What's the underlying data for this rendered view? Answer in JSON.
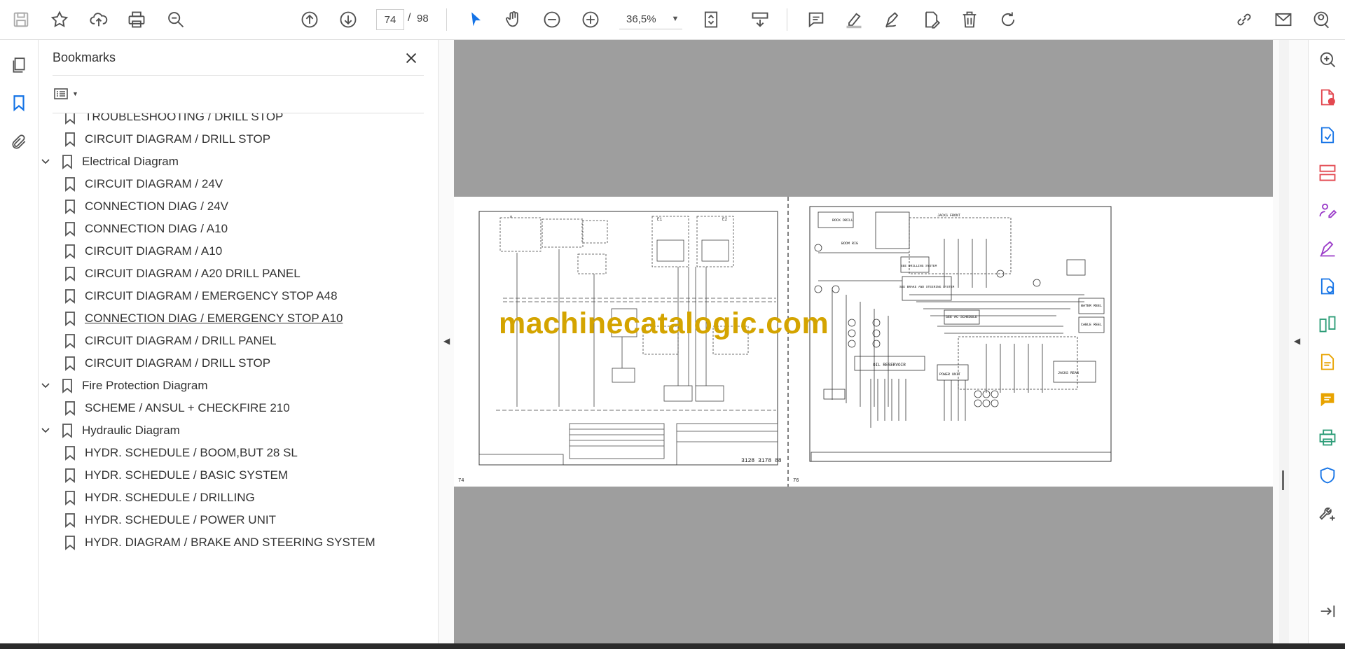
{
  "toolbar": {
    "current_page": "74",
    "page_separator": "/",
    "total_pages": "98",
    "zoom": "36,5%"
  },
  "bookmarks": {
    "title": "Bookmarks",
    "items": [
      {
        "label": "TROUBLESHOOTING / DRILL STOP",
        "level": 2
      },
      {
        "label": "CIRCUIT DIAGRAM / DRILL STOP",
        "level": 2
      },
      {
        "label": "Electrical Diagram",
        "level": 1,
        "expanded": true
      },
      {
        "label": "CIRCUIT DIAGRAM / 24V",
        "level": 2
      },
      {
        "label": "CONNECTION DIAG / 24V",
        "level": 2
      },
      {
        "label": "CONNECTION DIAG / A10",
        "level": 2
      },
      {
        "label": "CIRCUIT DIAGRAM / A10",
        "level": 2
      },
      {
        "label": "CIRCUIT DIAGRAM / A20 DRILL PANEL",
        "level": 2
      },
      {
        "label": "CIRCUIT DIAGRAM / EMERGENCY STOP A48",
        "level": 2
      },
      {
        "label": "CONNECTION DIAG / EMERGENCY STOP A10",
        "level": 2,
        "active": true
      },
      {
        "label": "CIRCUIT DIAGRAM / DRILL PANEL",
        "level": 2
      },
      {
        "label": "CIRCUIT DIAGRAM / DRILL STOP",
        "level": 2
      },
      {
        "label": "Fire Protection Diagram",
        "level": 1,
        "expanded": true
      },
      {
        "label": "SCHEME / ANSUL + CHECKFIRE 210",
        "level": 2
      },
      {
        "label": "Hydraulic Diagram",
        "level": 1,
        "expanded": true
      },
      {
        "label": "HYDR. SCHEDULE / BOOM,BUT 28 SL",
        "level": 2
      },
      {
        "label": "HYDR. SCHEDULE / BASIC SYSTEM",
        "level": 2
      },
      {
        "label": "HYDR. SCHEDULE / DRILLING",
        "level": 2
      },
      {
        "label": "HYDR. SCHEDULE / POWER UNIT",
        "level": 2
      },
      {
        "label": "HYDR. DIAGRAM / BRAKE AND STEERING SYSTEM",
        "level": 2
      }
    ]
  },
  "document": {
    "watermark": "machinecatalogic.com",
    "left_page_number": "74",
    "right_page_number": "76",
    "left_drawing_number": "3128 3178 88",
    "right_labels": {
      "rock_drill": "ROCK DRILL",
      "boom_rig": "BOOM RIG",
      "jacks_front": "JACKS FRONT",
      "jacks_rear": "JACKS REAR",
      "drilling_system": "SEE DRILLING SYSTEM",
      "brake_steering": "SEE BRAKE AND STEERING SYSTEM",
      "ac_schedule": "SEE AC SCHEDULE",
      "oil_reservoir": "OIL RESERVOIR",
      "power_unit": "POWER UNIT",
      "water_reel": "WATER REEL",
      "cable_reel": "CABLE REEL"
    }
  },
  "colors": {
    "accent": "#1473e6",
    "doc_background": "#9e9e9e",
    "watermark": "#d4a400"
  }
}
